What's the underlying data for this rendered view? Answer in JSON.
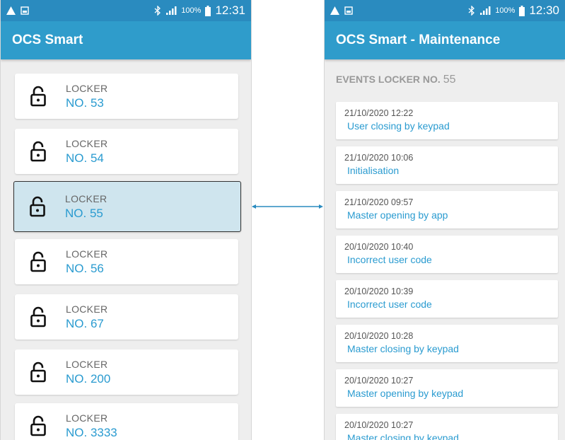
{
  "status_bar": {
    "left": {
      "time": "12:31",
      "battery": "100%"
    },
    "right": {
      "time": "12:30",
      "battery": "100%"
    }
  },
  "left_screen": {
    "app_title": "OCS Smart",
    "lockers": [
      {
        "label": "LOCKER",
        "number": "NO. 53"
      },
      {
        "label": "LOCKER",
        "number": "NO. 54"
      },
      {
        "label": "LOCKER",
        "number": "NO. 55",
        "selected": true
      },
      {
        "label": "LOCKER",
        "number": "NO. 56"
      },
      {
        "label": "LOCKER",
        "number": "NO. 67"
      },
      {
        "label": "LOCKER",
        "number": "NO. 200"
      },
      {
        "label": "LOCKER",
        "number": "NO. 3333"
      }
    ]
  },
  "right_screen": {
    "app_title": "OCS Smart - Maintenance",
    "events_title": "EVENTS LOCKER NO.",
    "events_title_number": "55",
    "events": [
      {
        "time": "21/10/2020 12:22",
        "description": "User closing by keypad"
      },
      {
        "time": "21/10/2020 10:06",
        "description": "Initialisation"
      },
      {
        "time": "21/10/2020 09:57",
        "description": "Master opening by app"
      },
      {
        "time": "20/10/2020 10:40",
        "description": "Incorrect user code"
      },
      {
        "time": "20/10/2020 10:39",
        "description": "Incorrect user code"
      },
      {
        "time": "20/10/2020 10:28",
        "description": "Master closing by keypad"
      },
      {
        "time": "20/10/2020 10:27",
        "description": "Master opening by keypad"
      },
      {
        "time": "20/10/2020 10:27",
        "description": "Master closing by keypad"
      }
    ]
  },
  "colors": {
    "status_bar": "#2a8bbf",
    "app_bar": "#2f9ccb",
    "accent_text": "#2a9bd0",
    "selected_card": "#cfe5ee",
    "connector": "#2a8bbf"
  },
  "icons": {
    "locker": "unlocked-padlock-icon",
    "status_left": [
      "warning-icon",
      "image-icon"
    ],
    "status_right": [
      "bluetooth-icon",
      "signal-icon",
      "battery-icon"
    ]
  }
}
